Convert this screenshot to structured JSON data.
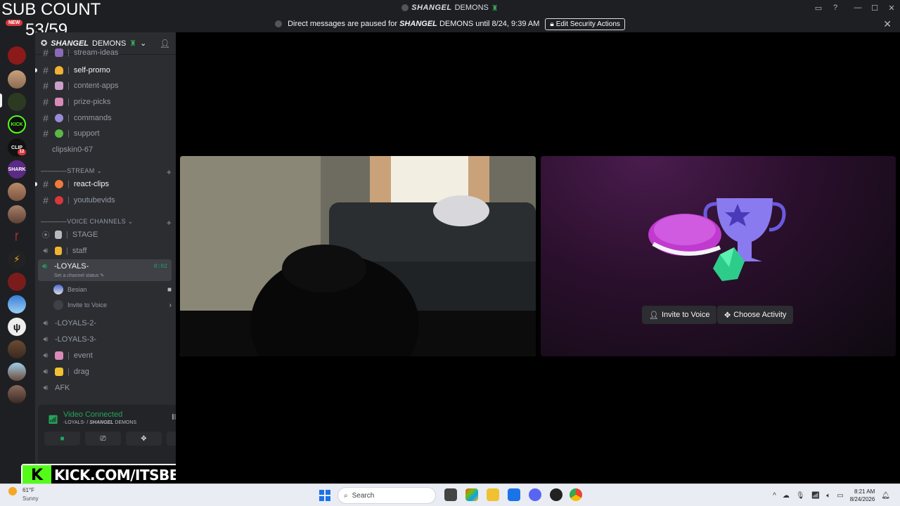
{
  "titlebar": {
    "server_name_bold": "SHANGEL",
    "server_name_rest": "DEMONS",
    "controls": [
      "▭",
      "?",
      "—",
      "☐",
      "✕"
    ]
  },
  "notice": {
    "message_prefix": "Direct messages are paused for",
    "server_bold": "SHANGEL",
    "server_rest": "DEMONS",
    "message_suffix": "until 8/24, 9:39 AM",
    "button_label": "Edit Security Actions"
  },
  "overlay": {
    "sub_count_label": "SUB COUNT",
    "sub_count_value": "53/59",
    "new_badge": "NEW",
    "kick_logo": "K",
    "kick_url": "KICK.COM/ITSBESIAN"
  },
  "rail": {
    "kick_label": "KICK",
    "clip_label": "CLIP",
    "badge_count": "12",
    "shark_label": "SHARK"
  },
  "guild": {
    "name_bold": "SHANGEL",
    "name_rest": "DEMONS"
  },
  "channels": {
    "partial": "stream-ideas",
    "self_promo": "self-promo",
    "content_apps": "content-apps",
    "prize_picks": "prize-picks",
    "commands": "commands",
    "support": "support",
    "clipskin": "clipskin0-67",
    "sep": "|"
  },
  "categories": {
    "stream": "————STREAM",
    "voice": "————VOICE CHANNELS"
  },
  "stream_channels": {
    "react_clips": "react-clips",
    "youtubevids": "youtubevids"
  },
  "voice_channels": {
    "stage": "STAGE",
    "staff": "staff",
    "active": "-LOYALS-",
    "active_timer": "0:02",
    "active_status": "Set a channel status",
    "user": "Besian",
    "invite": "Invite to Voice",
    "loyals2": "-LOYALS-2-",
    "loyals3": "-LOYALS-3-",
    "event": "event",
    "drag": "drag",
    "afk": "AFK"
  },
  "voice_panel": {
    "title": "Video Connected",
    "subtitle_prefix": "-LOYALS- /",
    "subtitle_bold": "SHANGEL",
    "subtitle_rest": "DEMONS"
  },
  "activity": {
    "invite_label": "Invite to Voice",
    "choose_label": "Choose Activity"
  },
  "taskbar": {
    "temp": "61°F",
    "weather": "Sunny",
    "search_placeholder": "Search",
    "time": "8:21 AM",
    "date": "8/24/2026"
  },
  "colors": {
    "accent_green": "#23a55a",
    "kick_green": "#53fc18",
    "sidebar_bg": "#2b2d31",
    "rail_bg": "#1e1f22"
  }
}
